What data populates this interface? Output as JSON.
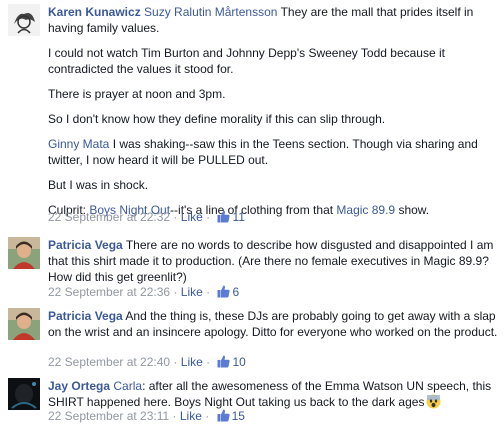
{
  "comments": [
    {
      "author": "Karen Kunawicz",
      "tagged": "Suzy Ralutin Mårtensson",
      "line1_text": " They are the mall that prides itself in having family values.",
      "p2": "I could not watch Tim Burton and Johnny Depp's Sweeney Todd because it contradicted the values it stood for.",
      "p3": "There is prayer at noon and 3pm.",
      "p4": "So I don't know how they define morality if this can slip through.",
      "p5_tag": "Ginny Mata",
      "p5_text": " I was shaking--saw this in the Teens section. Though via sharing and twitter, I now heard it will be PULLED out.",
      "p6": "But I was in shock.",
      "p7_prefix": "Culprit: ",
      "p7_link1": "Boys Night Out",
      "p7_mid": "--it's a line of clothing from that ",
      "p7_link2": "Magic 89.9",
      "p7_suffix": " show.",
      "timestamp": "22 September at 22:32",
      "like_label": "Like",
      "like_count": "11"
    },
    {
      "author": "Patricia Vega",
      "text": " There are no words to describe how disgusted and disappointed I am that this shirt made it to production. (Are there no female executives in Magic 89.9? How did this get greenlit?)",
      "timestamp": "22 September at 22:36",
      "like_label": "Like",
      "like_count": "6"
    },
    {
      "author": "Patricia Vega",
      "text": " And the thing is, these DJs are probably going to get away with a slap on the wrist and an insincere apology. Ditto for everyone who worked on the product.",
      "timestamp": "22 September at 22:40",
      "like_label": "Like",
      "like_count": "10"
    },
    {
      "author": "Jay Ortega",
      "tagged": "Carla",
      "text": ": after all the awesomeness of the Emma Watson UN speech, this SHIRT happened here. Boys Night Out taking us back to the dark ages",
      "timestamp": "22 September at 23:11",
      "like_label": "Like",
      "like_count": "15"
    }
  ],
  "separator": " · ",
  "colors": {
    "link": "#3b5998",
    "meta": "#9197a3",
    "text": "#141823"
  }
}
